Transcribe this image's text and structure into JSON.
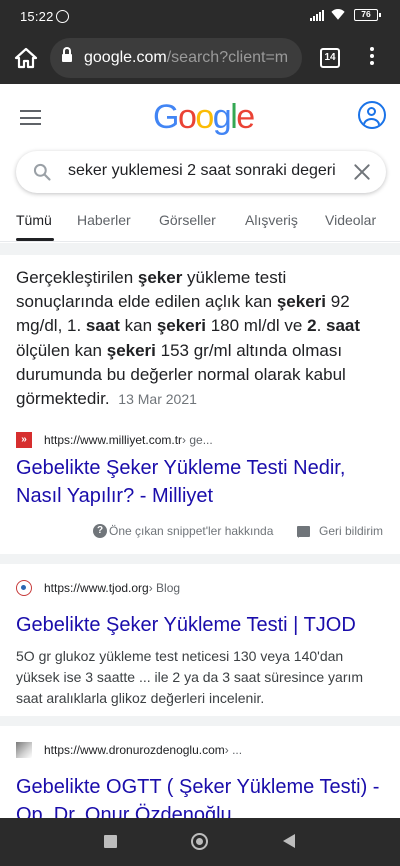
{
  "status_bar": {
    "time": "15:22",
    "battery": "76"
  },
  "browser": {
    "url_host": "google.com",
    "url_path": "/search?client=m",
    "tab_count": "14"
  },
  "google": {
    "logo_letters": [
      "G",
      "o",
      "o",
      "g",
      "l",
      "e"
    ]
  },
  "search": {
    "query": "seker yuklemesi 2 saat sonraki degeri"
  },
  "tabs": [
    {
      "label": "Tümü"
    },
    {
      "label": "Haberler"
    },
    {
      "label": "Görseller"
    },
    {
      "label": "Alışveriş"
    },
    {
      "label": "Videolar"
    }
  ],
  "featured_snippet": {
    "text_parts": [
      "Gerçekleştirilen ",
      "şeker",
      " yükleme testi sonuçlarında elde edilen açlık kan ",
      "şekeri",
      " 92 mg/dl, 1. ",
      "saat",
      " kan ",
      "şekeri",
      " 180 ml/dl ve ",
      "2",
      ". ",
      "saat",
      " ölçülen kan ",
      "şekeri",
      " 153 gr/ml altında olması durumunda bu değerler normal olarak kabul görmektedir."
    ],
    "date": "13 Mar 2021",
    "source_url": "https://www.milliyet.com.tr",
    "source_crumb": " › ge...",
    "title": "Gebelikte Şeker Yükleme Testi Nedir, Nasıl Yapılır? - Milliyet",
    "about_label": "Öne çıkan snippet'ler hakkında",
    "feedback_label": "Geri bildirim"
  },
  "results": [
    {
      "source_url": "https://www.tjod.org",
      "source_crumb": " › Blog",
      "title": "Gebelikte Şeker Yükleme Testi | TJOD",
      "description": "5O gr glukoz yükleme test neticesi 130 veya 140'dan yüksek ise 3 saatte ... ile 2 ya da 3 saat süresince yarım saat aralıklarla glikoz değerleri incelenir."
    },
    {
      "source_url": "https://www.dronurozdenoglu.com",
      "source_crumb": " › ...",
      "title": "Gebelikte OGTT ( Şeker Yükleme Testi) - Op. Dr. Onur Özdenoğlu"
    }
  ],
  "colors": {
    "link": "#1a0dab",
    "google_blue": "#4285f4",
    "google_red": "#ea4335",
    "google_yellow": "#fbbc05",
    "google_green": "#34a853"
  }
}
